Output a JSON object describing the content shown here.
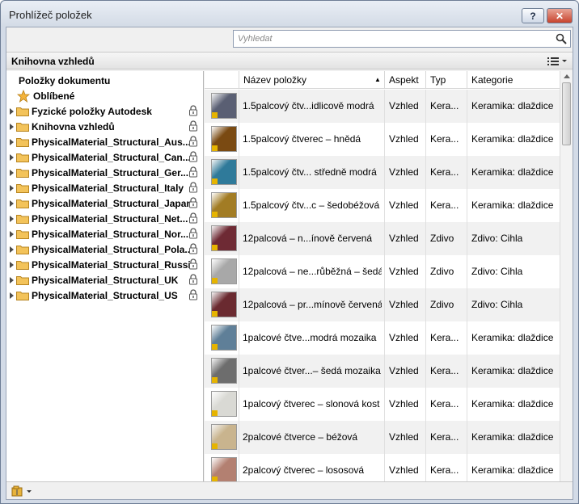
{
  "window": {
    "title": "Prohlížeč položek",
    "help_label": "?",
    "close_label": "✕"
  },
  "search": {
    "placeholder": "Vyhledat"
  },
  "library_bar": {
    "title": "Knihovna vzhledů"
  },
  "tree": {
    "document_items": "Položky dokumentu",
    "favorites": "Oblíbené",
    "libraries": [
      "Fyzické položky Autodesk",
      "Knihovna vzhledů",
      "PhysicalMaterial_Structural_Aus...",
      "PhysicalMaterial_Structural_Can...",
      "PhysicalMaterial_Structural_Ger...",
      "PhysicalMaterial_Structural_Italy",
      "PhysicalMaterial_Structural_Japan",
      "PhysicalMaterial_Structural_Net...",
      "PhysicalMaterial_Structural_Nor...",
      "PhysicalMaterial_Structural_Pola...",
      "PhysicalMaterial_Structural_Russia",
      "PhysicalMaterial_Structural_UK",
      "PhysicalMaterial_Structural_US"
    ]
  },
  "table": {
    "columns": {
      "name": "Název položky",
      "aspect": "Aspekt",
      "type": "Typ",
      "category": "Kategorie"
    },
    "rows": [
      {
        "name": "1.5palcový čtv...idlicově modrá",
        "aspect": "Vzhled",
        "type": "Kera...",
        "category": "Keramika: dlaždice",
        "color": "#5a5f73"
      },
      {
        "name": "1.5palcový čtverec – hnědá",
        "aspect": "Vzhled",
        "type": "Kera...",
        "category": "Keramika: dlaždice",
        "color": "#7a4a12"
      },
      {
        "name": "1.5palcový čtv... středně modrá",
        "aspect": "Vzhled",
        "type": "Kera...",
        "category": "Keramika: dlaždice",
        "color": "#2f7a9a"
      },
      {
        "name": "1.5palcový čtv...c – šedobéžová",
        "aspect": "Vzhled",
        "type": "Kera...",
        "category": "Keramika: dlaždice",
        "color": "#a27c24"
      },
      {
        "name": "12palcová – n...ínově červená",
        "aspect": "Vzhled",
        "type": "Zdivo",
        "category": "Zdivo: Cihla",
        "color": "#6e2a34"
      },
      {
        "name": "12palcová – ne...růběžná – šedá",
        "aspect": "Vzhled",
        "type": "Zdivo",
        "category": "Zdivo: Cihla",
        "color": "#a8a8a8"
      },
      {
        "name": "12palcová – pr...mínově červená",
        "aspect": "Vzhled",
        "type": "Zdivo",
        "category": "Zdivo: Cihla",
        "color": "#6a2a30"
      },
      {
        "name": "1palcové čtve...modrá mozaika",
        "aspect": "Vzhled",
        "type": "Kera...",
        "category": "Keramika: dlaždice",
        "color": "#5f7f98"
      },
      {
        "name": "1palcové čtver...– šedá mozaika",
        "aspect": "Vzhled",
        "type": "Kera...",
        "category": "Keramika: dlaždice",
        "color": "#6d6d6d"
      },
      {
        "name": "1palcový čtverec – slonová kost",
        "aspect": "Vzhled",
        "type": "Kera...",
        "category": "Keramika: dlaždice",
        "color": "#d9d9d4"
      },
      {
        "name": "2palcové čtverce – béžová",
        "aspect": "Vzhled",
        "type": "Kera...",
        "category": "Keramika: dlaždice",
        "color": "#c9b48e"
      },
      {
        "name": "2palcový čtverec – lososová",
        "aspect": "Vzhled",
        "type": "Kera...",
        "category": "Keramika: dlaždice",
        "color": "#b38071"
      }
    ]
  }
}
